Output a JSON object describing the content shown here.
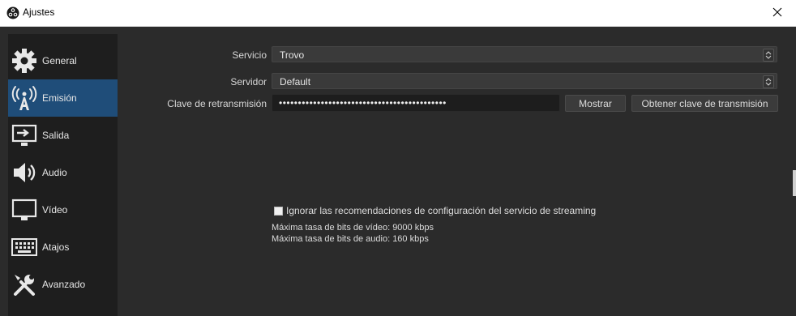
{
  "window": {
    "title": "Ajustes",
    "app_icon": "obs-logo-icon",
    "close_icon": "close-icon"
  },
  "sidebar": {
    "items": [
      {
        "label": "General",
        "icon": "gear-icon",
        "active": false
      },
      {
        "label": "Emisión",
        "icon": "broadcast-antenna-icon",
        "active": true
      },
      {
        "label": "Salida",
        "icon": "output-monitor-icon",
        "active": false
      },
      {
        "label": "Audio",
        "icon": "speaker-icon",
        "active": false
      },
      {
        "label": "Vídeo",
        "icon": "monitor-icon",
        "active": false
      },
      {
        "label": "Atajos",
        "icon": "keyboard-icon",
        "active": false
      },
      {
        "label": "Avanzado",
        "icon": "tools-icon",
        "active": false
      }
    ]
  },
  "stream": {
    "service_label": "Servicio",
    "service_value": "Trovo",
    "server_label": "Servidor",
    "server_value": "Default",
    "key_label": "Clave de retransmisión",
    "key_value": "••••••••••••••••••••••••••••••••••••••••••••",
    "show_button": "Mostrar",
    "get_key_button": "Obtener clave de transmisión",
    "ignore_checkbox_label": "Ignorar las recomendaciones de configuración del servicio de streaming",
    "ignore_checked": false,
    "max_video_bitrate": "Máxima tasa de bits de vídeo: 9000 kbps",
    "max_audio_bitrate": "Máxima tasa de bits de audio: 160 kbps"
  },
  "colors": {
    "background": "#2b2b2b",
    "sidebar": "#1e1e1e",
    "accent": "#1f4d79"
  }
}
